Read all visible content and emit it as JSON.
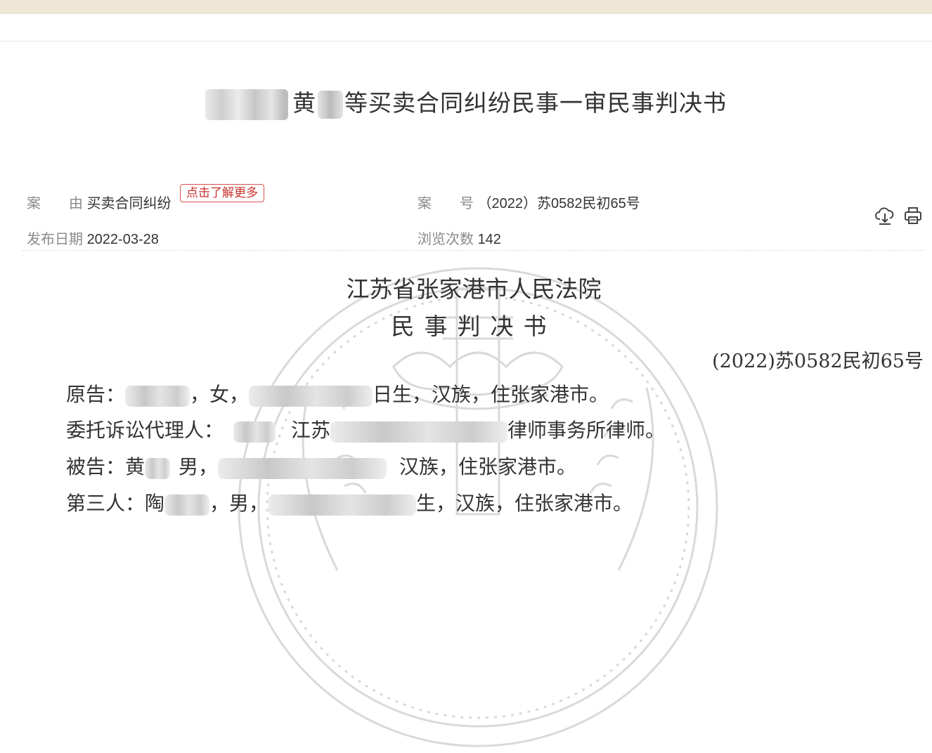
{
  "document": {
    "title": "黄 等买卖合同纠纷民事一审民事判决书",
    "title_before": "黄",
    "title_after": "等买卖合同纠纷民事一审民事判决书"
  },
  "meta": {
    "cause_label": "案　　由",
    "cause_value": "买卖合同纠纷",
    "learn_more": "点击了解更多",
    "case_no_label": "案　　号",
    "case_no_value": "（2022）苏0582民初65号",
    "publish_label": "发布日期",
    "publish_value": "2022-03-28",
    "views_label": "浏览次数",
    "views_value": "142"
  },
  "toolbar": {
    "download_icon": "cloud-download-icon",
    "print_icon": "printer-icon"
  },
  "body": {
    "court": "江苏省张家港市人民法院",
    "doc_type": "民事判决书",
    "case_no": "(2022)苏0582民初65号",
    "plaintiff_label": "原告：",
    "plaintiff_gender": "，女，",
    "plaintiff_tail": "日生，汉族，住张家港市。",
    "agent_label": "委托诉讼代理人：",
    "agent_firm_start": "江苏",
    "agent_firm_end": "律师事务所律师。",
    "defendant_label": "被告：黄",
    "defendant_gender": "男，",
    "defendant_tail": "汉族，住张家港市。",
    "third_label": "第三人：陶",
    "third_gender": "，男，",
    "third_tail": "生，汉族，住张家港市。"
  }
}
